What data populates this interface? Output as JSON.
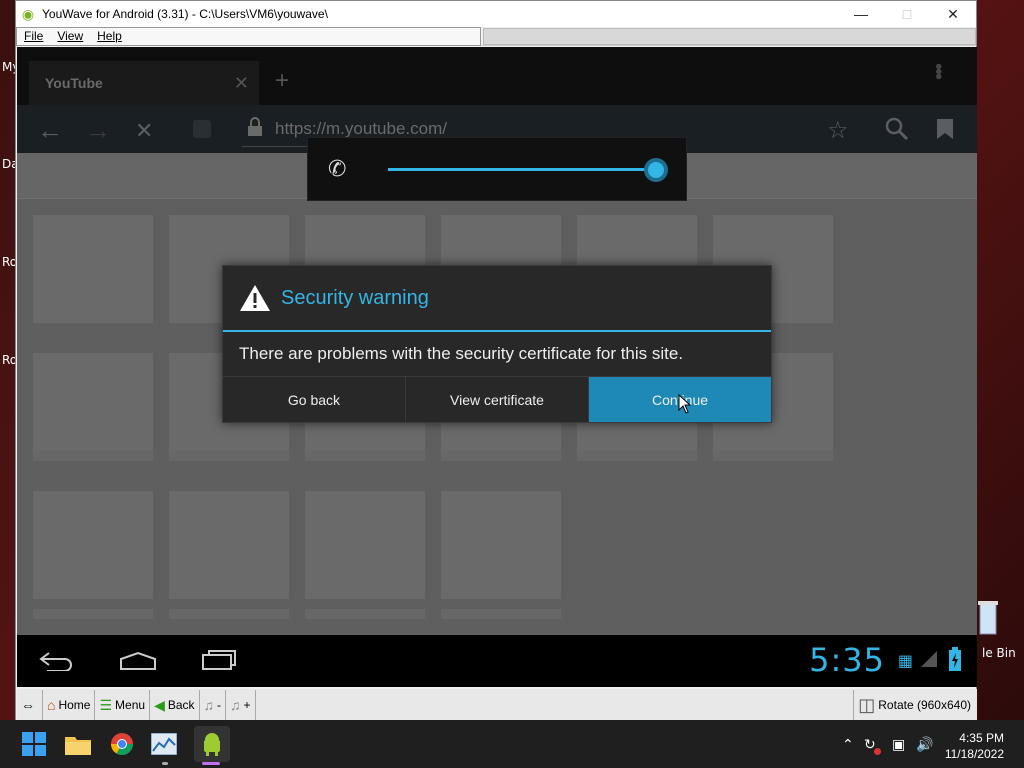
{
  "desktop": {
    "left_labels": [
      "My",
      "Da",
      "Ro",
      "Ro"
    ],
    "recycle_label": "le Bin"
  },
  "window": {
    "title": "YouWave for Android (3.31) - C:\\Users\\VM6\\youwave\\",
    "menu": [
      "File",
      "View",
      "Help"
    ]
  },
  "browser": {
    "tab_title": "YouTube",
    "url": "https://m.youtube.com/"
  },
  "dialog": {
    "title": "Security warning",
    "message": "There are problems with the security certificate for this site.",
    "buttons": [
      "Go back",
      "View certificate",
      "Continue"
    ]
  },
  "volume": {
    "level": 1.0
  },
  "android_nav": {
    "clock": "5:35"
  },
  "toolbar": {
    "home": "Home",
    "menu": "Menu",
    "back": "Back",
    "minus": "-",
    "plus": "+",
    "rotate": "Rotate (960x640)"
  },
  "taskbar": {
    "time": "4:35 PM",
    "date": "11/18/2022"
  },
  "colors": {
    "accent": "#33b5e5",
    "primary_button": "#1f89b5"
  }
}
